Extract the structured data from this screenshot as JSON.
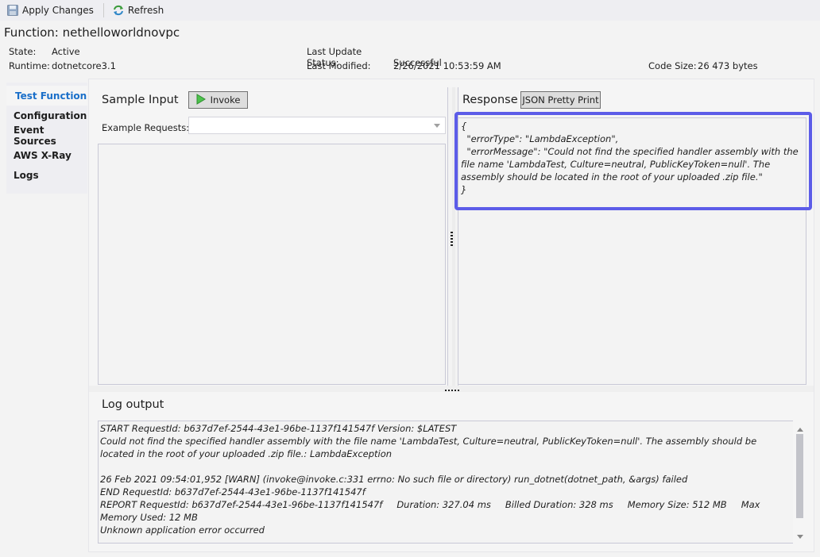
{
  "toolbar": {
    "apply_changes": "Apply Changes",
    "refresh": "Refresh",
    "apply_icon": "save-disk-icon",
    "refresh_icon": "refresh-arrows-icon"
  },
  "function": {
    "title": "Function: nethelloworldnovpc",
    "state_label": "State:",
    "state_value": "Active",
    "runtime_label": "Runtime:",
    "runtime_value": "dotnetcore3.1",
    "last_update_status_label": "Last Update Status:",
    "last_update_status_value": "Successful",
    "last_modified_label": "Last Modified:",
    "last_modified_value": "2/26/2021 10:53:59 AM",
    "code_size_label": "Code Size:",
    "code_size_value": "26 473 bytes"
  },
  "sidebar": {
    "items": [
      {
        "label": "Test Function",
        "active": true
      },
      {
        "label": "Configuration",
        "active": false
      },
      {
        "label": "Event Sources",
        "active": false
      },
      {
        "label": "AWS X-Ray",
        "active": false
      },
      {
        "label": "Logs",
        "active": false
      }
    ]
  },
  "sample_input": {
    "title": "Sample Input",
    "invoke_label": "Invoke",
    "invoke_icon": "play-triangle-icon",
    "example_requests_label": "Example Requests:",
    "example_requests_value": "",
    "input_text": ""
  },
  "response": {
    "title": "Response",
    "pretty_print_label": "JSON Pretty Print",
    "text": "{\n  \"errorType\": \"LambdaException\",\n  \"errorMessage\": \"Could not find the specified handler assembly with the file name 'LambdaTest, Culture=neutral, PublicKeyToken=null'. The assembly should be located in the root of your uploaded .zip file.\"\n}",
    "highlight_color": "#5c5ce8"
  },
  "log_output": {
    "title": "Log output",
    "lines": [
      "START RequestId: b637d7ef-2544-43e1-96be-1137f141547f Version: $LATEST",
      "Could not find the specified handler assembly with the file name 'LambdaTest, Culture=neutral, PublicKeyToken=null'. The assembly should be located in the root of your uploaded .zip file.: LambdaException",
      "",
      "26 Feb 2021 09:54:01,952 [WARN] (invoke@invoke.c:331 errno: No such file or directory) run_dotnet(dotnet_path, &args) failed",
      "END RequestId: b637d7ef-2544-43e1-96be-1137f141547f",
      "REPORT RequestId: b637d7ef-2544-43e1-96be-1137f141547f\tDuration: 327.04 ms\tBilled Duration: 328 ms\tMemory Size: 512 MB\tMax Memory Used: 12 MB",
      "Unknown application error occurred"
    ]
  },
  "colors": {
    "active_nav": "#1a6fc9",
    "highlight": "#5c5ce8"
  }
}
